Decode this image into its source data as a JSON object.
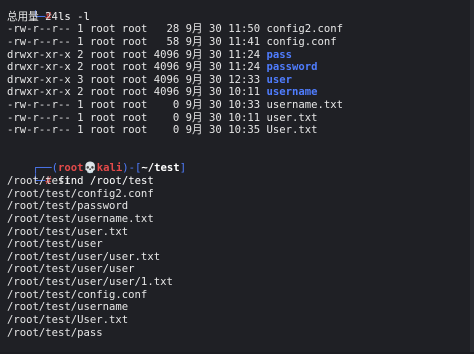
{
  "top_prompt": {
    "corner": "└─",
    "symbol": "#",
    "command": " ls -l"
  },
  "total_line": "总用量 24",
  "ls_rows": [
    {
      "perms": "-rw-r--r--",
      "links": "1",
      "owner": "root",
      "group": "root",
      "size": "  28",
      "month": "9月",
      "day": "30",
      "time": "11:50",
      "name": "config2.conf",
      "is_dir": false
    },
    {
      "perms": "-rw-r--r--",
      "links": "1",
      "owner": "root",
      "group": "root",
      "size": "  58",
      "month": "9月",
      "day": "30",
      "time": "11:41",
      "name": "config.conf",
      "is_dir": false
    },
    {
      "perms": "drwxr-xr-x",
      "links": "2",
      "owner": "root",
      "group": "root",
      "size": "4096",
      "month": "9月",
      "day": "30",
      "time": "11:24",
      "name": "pass",
      "is_dir": true
    },
    {
      "perms": "drwxr-xr-x",
      "links": "2",
      "owner": "root",
      "group": "root",
      "size": "4096",
      "month": "9月",
      "day": "30",
      "time": "11:24",
      "name": "password",
      "is_dir": true
    },
    {
      "perms": "drwxr-xr-x",
      "links": "3",
      "owner": "root",
      "group": "root",
      "size": "4096",
      "month": "9月",
      "day": "30",
      "time": "12:33",
      "name": "user",
      "is_dir": true
    },
    {
      "perms": "drwxr-xr-x",
      "links": "2",
      "owner": "root",
      "group": "root",
      "size": "4096",
      "month": "9月",
      "day": "30",
      "time": "10:11",
      "name": "username",
      "is_dir": true
    },
    {
      "perms": "-rw-r--r--",
      "links": "1",
      "owner": "root",
      "group": "root",
      "size": "   0",
      "month": "9月",
      "day": "30",
      "time": "10:33",
      "name": "username.txt",
      "is_dir": false
    },
    {
      "perms": "-rw-r--r--",
      "links": "1",
      "owner": "root",
      "group": "root",
      "size": "   0",
      "month": "9月",
      "day": "30",
      "time": "10:11",
      "name": "user.txt",
      "is_dir": false
    },
    {
      "perms": "-rw-r--r--",
      "links": "1",
      "owner": "root",
      "group": "root",
      "size": "   0",
      "month": "9月",
      "day": "30",
      "time": "10:35",
      "name": "User.txt",
      "is_dir": false
    }
  ],
  "prompt": {
    "open": "┌──(",
    "user": "root",
    "skull": "💀",
    "host": "kali",
    "close": ")-[",
    "cwd": "~/test",
    "end": "]",
    "corner": "└─",
    "symbol": "#",
    "command": " find /root/test"
  },
  "find_output": [
    "/root/test",
    "/root/test/config2.conf",
    "/root/test/password",
    "/root/test/username.txt",
    "/root/test/user.txt",
    "/root/test/user",
    "/root/test/user/user.txt",
    "/root/test/user/user",
    "/root/test/user/user/1.txt",
    "/root/test/config.conf",
    "/root/test/username",
    "/root/test/User.txt",
    "/root/test/pass"
  ],
  "colors": {
    "background": "#1f2025",
    "prompt_red": "#e34a4a",
    "prompt_blue": "#4f7dff",
    "text": "#e6e6e6"
  }
}
